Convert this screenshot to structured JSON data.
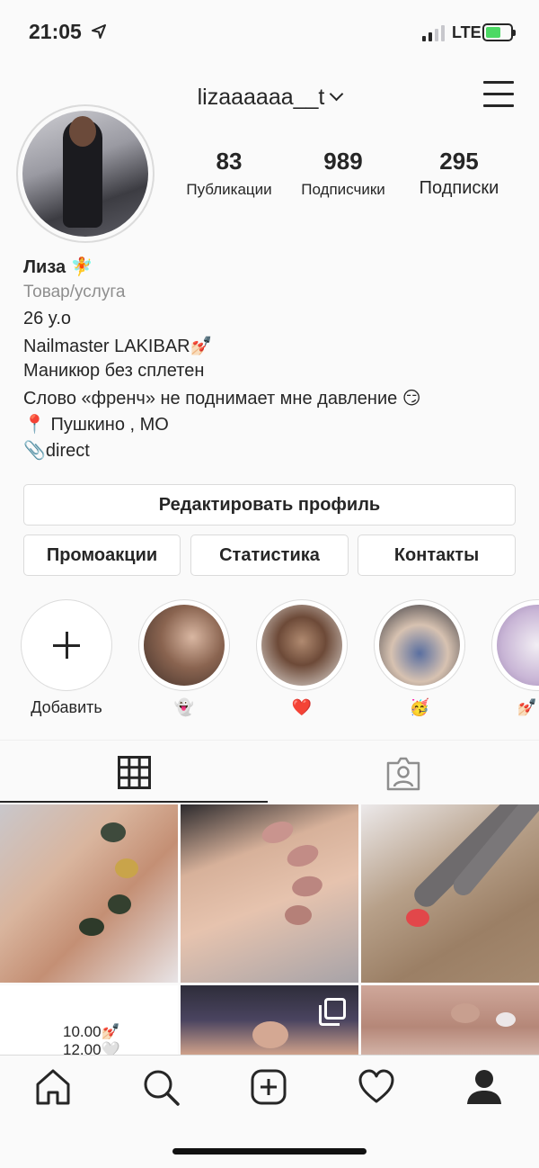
{
  "status_bar": {
    "time": "21:05",
    "network": "LTE",
    "battery_color": "#4cd964"
  },
  "header": {
    "username": "lizaaaaaa__t",
    "menu_icon": "hamburger-icon"
  },
  "profile": {
    "stats": [
      {
        "count": "83",
        "label": "Публикации"
      },
      {
        "count": "989",
        "label": "Подписчики"
      },
      {
        "count": "295",
        "label": "Подписки"
      }
    ],
    "name": "Лиза 🧚",
    "category": "Товар/услуга",
    "bio_lines": [
      "26 y.o",
      "Nailmaster LAKIBAR💅🏻",
      "Маникюр без сплетен",
      "Слово «френч» не поднимает мне давление 😏",
      "📍 Пушкино , МО",
      "📎direct"
    ]
  },
  "buttons": {
    "edit_profile": "Редактировать профиль",
    "promotions": "Промоакции",
    "statistics": "Статистика",
    "contacts": "Контакты"
  },
  "highlights": [
    {
      "label": "Добавить",
      "type": "add"
    },
    {
      "label": "👻"
    },
    {
      "label": "❤️"
    },
    {
      "label": "🥳"
    },
    {
      "label": "💅🏻"
    }
  ],
  "tabs": [
    {
      "icon": "grid-icon",
      "active": true
    },
    {
      "icon": "tagged-icon",
      "active": false
    }
  ],
  "grid_posts": [
    {
      "caption": ""
    },
    {
      "caption": ""
    },
    {
      "caption": ""
    },
    {
      "caption_lines": [
        "10.00💅🏻",
        "12.00🤍"
      ]
    },
    {
      "caption": "",
      "multiple": true
    },
    {
      "caption": ""
    }
  ],
  "nav": [
    "home-icon",
    "search-icon",
    "new-post-icon",
    "activity-heart-icon",
    "profile-icon"
  ],
  "colors": {
    "accent": "#262626",
    "secondary_text": "#8e8e8e",
    "border": "#dbdbdb",
    "background": "#fafafa"
  }
}
